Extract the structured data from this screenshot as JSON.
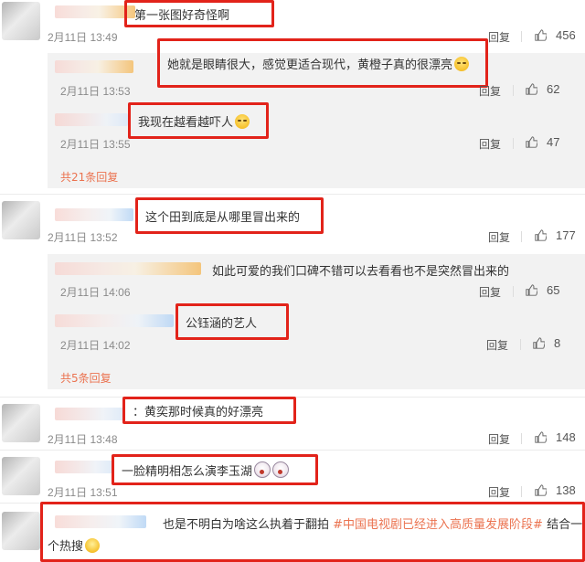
{
  "comments": [
    {
      "text": "第一张图好奇怪啊",
      "time": "2月11日 13:49",
      "reply": "回复",
      "likes": "456"
    },
    {
      "text": "她就是眼睛很大，感觉更适合现代，黄橙子真的很漂亮",
      "time": "2月11日 13:53",
      "reply": "回复",
      "likes": "62"
    },
    {
      "text": "我现在越看越吓人",
      "time": "2月11日 13:55",
      "reply": "回复",
      "likes": "47"
    },
    {
      "more": "共21条回复"
    },
    {
      "text": "这个田到底是从哪里冒出来的",
      "time": "2月11日 13:52",
      "reply": "回复",
      "likes": "177"
    },
    {
      "text": "如此可爱的我们口碑不错可以去看看也不是突然冒出来的",
      "time": "2月11日 14:06",
      "reply": "回复",
      "likes": "65"
    },
    {
      "text": "公钰涵的艺人",
      "time": "2月11日 14:02",
      "reply": "回复",
      "likes": "8"
    },
    {
      "more": "共5条回复"
    },
    {
      "text": "：黄奕那时候真的好漂亮",
      "time": "2月11日 13:48",
      "reply": "回复",
      "likes": "148"
    },
    {
      "text": "一脸精明相怎么演李玉湖",
      "time": "2月11日 13:51",
      "reply": "回复",
      "likes": "138"
    },
    {
      "text_a": "也是不明白为啥这么执着于翻拍",
      "topic": "#中国电视剧已经进入高质量发展阶段#",
      "text_b": "结合一",
      "text_c": "个热搜"
    }
  ],
  "colors": {
    "highlight_border": "#e2231a",
    "link_orange": "#eb7350",
    "reply_bg": "#f2f2f2"
  },
  "icons": [
    "thumbs-up-icon",
    "laugh-cry-emoji",
    "shock-emoji",
    "thinking-emoji"
  ]
}
